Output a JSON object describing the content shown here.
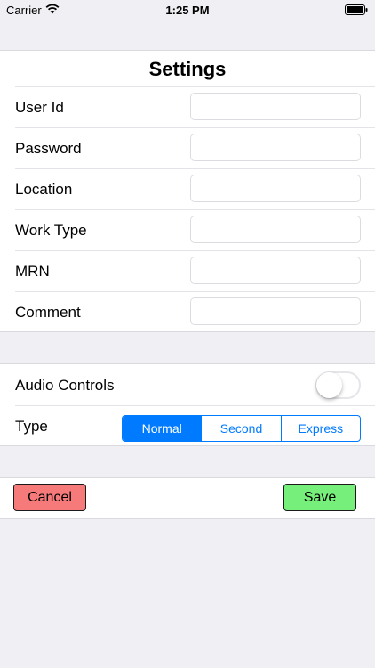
{
  "status_bar": {
    "carrier": "Carrier",
    "time": "1:25 PM"
  },
  "settings": {
    "title": "Settings",
    "fields": [
      {
        "label": "User Id",
        "value": ""
      },
      {
        "label": "Password",
        "value": ""
      },
      {
        "label": "Location",
        "value": ""
      },
      {
        "label": "Work Type",
        "value": ""
      },
      {
        "label": "MRN",
        "value": ""
      },
      {
        "label": "Comment",
        "value": ""
      }
    ]
  },
  "audio": {
    "label": "Audio Controls",
    "toggle_on": false,
    "type_label": "Type",
    "type_options": [
      "Normal",
      "Second",
      "Express"
    ],
    "type_selected": "Normal",
    "accent_color": "#007aff"
  },
  "actions": {
    "cancel_label": "Cancel",
    "cancel_color": "#f67a7a",
    "save_label": "Save",
    "save_color": "#76f07a"
  }
}
